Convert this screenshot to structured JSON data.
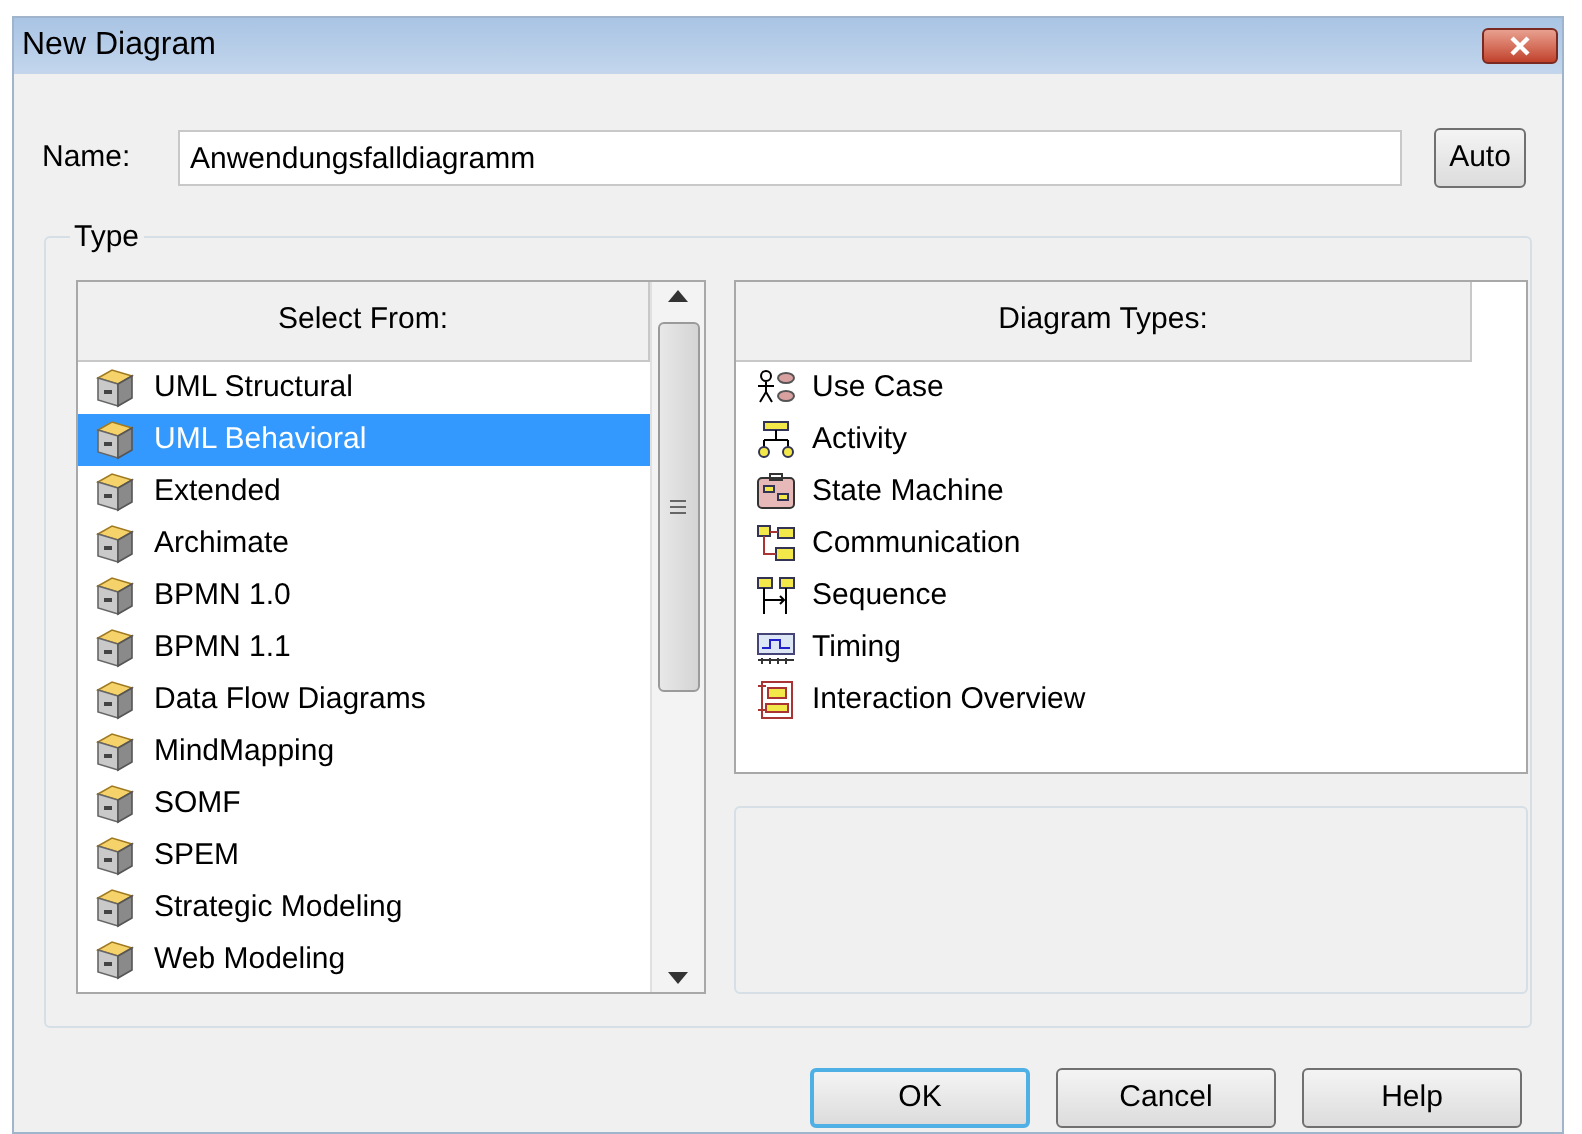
{
  "window": {
    "title": "New Diagram"
  },
  "name_field": {
    "label": "Name:",
    "value": "Anwendungsfalldiagramm"
  },
  "auto_button": "Auto",
  "type_group": {
    "label": "Type"
  },
  "select_from": {
    "header": "Select From:",
    "items": [
      {
        "label": "UML Structural",
        "selected": false
      },
      {
        "label": "UML Behavioral",
        "selected": true
      },
      {
        "label": "Extended",
        "selected": false
      },
      {
        "label": "Archimate",
        "selected": false
      },
      {
        "label": "BPMN 1.0",
        "selected": false
      },
      {
        "label": "BPMN 1.1",
        "selected": false
      },
      {
        "label": "Data Flow Diagrams",
        "selected": false
      },
      {
        "label": "MindMapping",
        "selected": false
      },
      {
        "label": "SOMF",
        "selected": false
      },
      {
        "label": "SPEM",
        "selected": false
      },
      {
        "label": "Strategic Modeling",
        "selected": false
      },
      {
        "label": "Web Modeling",
        "selected": false
      }
    ]
  },
  "diagram_types": {
    "header": "Diagram Types:",
    "items": [
      {
        "label": "Use Case",
        "selected": false
      },
      {
        "label": "Activity",
        "selected": false
      },
      {
        "label": "State Machine",
        "selected": false
      },
      {
        "label": "Communication",
        "selected": false
      },
      {
        "label": "Sequence",
        "selected": false
      },
      {
        "label": "Timing",
        "selected": false
      },
      {
        "label": "Interaction Overview",
        "selected": false
      }
    ]
  },
  "buttons": [
    {
      "label": "OK",
      "default": true
    },
    {
      "label": "Cancel",
      "default": false
    },
    {
      "label": "Help",
      "default": false
    }
  ]
}
